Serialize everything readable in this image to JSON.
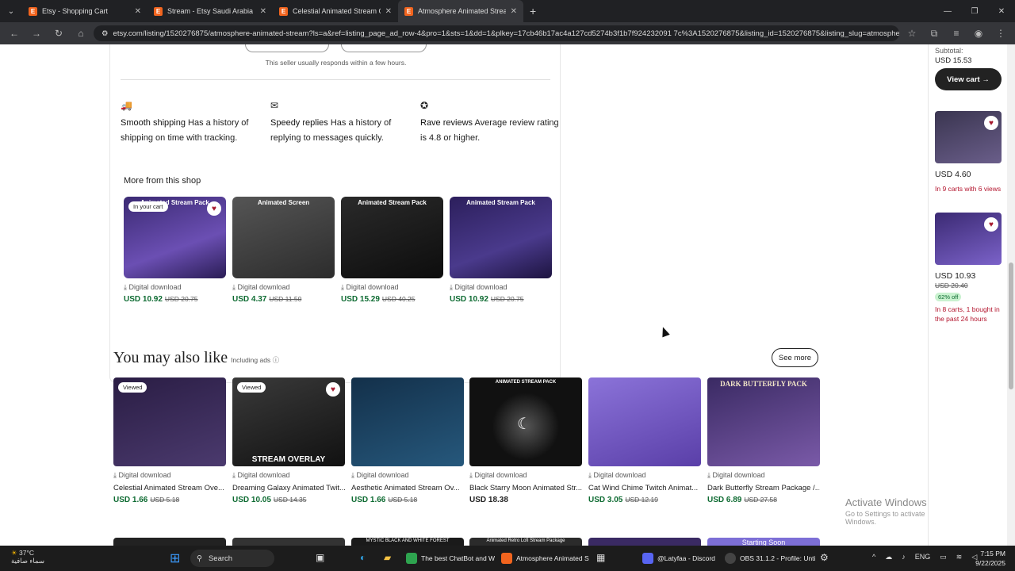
{
  "browser": {
    "tabs": [
      {
        "title": "Etsy - Shopping Cart",
        "active": false
      },
      {
        "title": "Stream - Etsy Saudi Arabia",
        "active": false
      },
      {
        "title": "Celestial Animated Stream Ove",
        "active": false
      },
      {
        "title": "Atmosphere Animated Stream",
        "active": true
      }
    ],
    "url": "etsy.com/listing/1520276875/atmosphere-animated-stream?ls=a&ref=listing_page_ad_row-4&pro=1&sts=1&dd=1&plkey=17cb46b17ac4a127cd5274b3f1b7f924232091 7c%3A1520276875&listing_id=1520276875&listing_slug=atmosphere-animated-stream-a"
  },
  "shop": {
    "response_note": "This seller usually responds within a few hours.",
    "features": [
      {
        "icon": "truck-icon",
        "title": "Smooth shipping",
        "desc": "Has a history of shipping on time with tracking."
      },
      {
        "icon": "envelope-icon",
        "title": "Speedy replies",
        "desc": "Has a history of replying to messages quickly."
      },
      {
        "icon": "star-badge-icon",
        "title": "Rave reviews",
        "desc": "Average review rating is 4.8 or higher."
      }
    ],
    "more_title": "More from this shop",
    "items": [
      {
        "label": "Animated Stream Pack",
        "badge": "In your cart",
        "favorited": true,
        "type": "Digital download",
        "price": "USD 10.92",
        "original": "USD 20.75",
        "bg": "#3b2a73"
      },
      {
        "label": "Animated Screen",
        "badge": "",
        "favorited": false,
        "type": "Digital download",
        "price": "USD 4.37",
        "original": "USD 11.50",
        "bg": "#3a3a3a"
      },
      {
        "label": "Animated Stream Pack",
        "badge": "",
        "favorited": false,
        "type": "Digital download",
        "price": "USD 15.29",
        "original": "USD 40.25",
        "bg": "#1a1a1a"
      },
      {
        "label": "Animated Stream Pack",
        "badge": "",
        "favorited": false,
        "type": "Digital download",
        "price": "USD 10.92",
        "original": "USD 20.75",
        "bg": "#2c1f5c"
      }
    ]
  },
  "recommend": {
    "title": "You may also like",
    "subtitle": "Including ads",
    "see_more": "See more",
    "items": [
      {
        "name": "Celestial Animated Stream Ove...",
        "badge": "Viewed",
        "favorited": false,
        "type": "Digital download",
        "price": "USD 1.66",
        "original": "USD 5.18",
        "bg": "#2a1d44"
      },
      {
        "name": "Dreaming Galaxy Animated Twit...",
        "badge": "Viewed",
        "favorited": true,
        "type": "Digital download",
        "price": "USD 10.05",
        "original": "USD 14.35",
        "bg": "#222222",
        "caption": "STREAM OVERLAY"
      },
      {
        "name": "Aesthetic Animated Stream Ov...",
        "badge": "",
        "favorited": false,
        "type": "Digital download",
        "price": "USD 1.66",
        "original": "USD 5.18",
        "bg": "#13304a"
      },
      {
        "name": "Black Starry Moon Animated Str...",
        "badge": "",
        "favorited": false,
        "type": "Digital download",
        "price": "USD 18.38",
        "original": "",
        "bg": "#111111",
        "caption_top": "ANIMATED STREAM PACK"
      },
      {
        "name": "Cat Wind Chime Twitch Animat...",
        "badge": "",
        "favorited": false,
        "type": "Digital download",
        "price": "USD 3.05",
        "original": "USD 12.19",
        "bg": "#6b4fb3"
      },
      {
        "name": "Dark Butterfly Stream Package /...",
        "badge": "",
        "favorited": false,
        "type": "Digital download",
        "price": "USD 6.89",
        "original": "USD 27.58",
        "bg": "#3a2a63",
        "caption_top": "DARK BUTTERFLY PACK"
      }
    ],
    "row_two": [
      {
        "label": "",
        "bg": "#222"
      },
      {
        "label": "",
        "bg": "#333"
      },
      {
        "label": "MYSTIC BLACK AND WHITE FOREST",
        "bg": "#1a1a1a"
      },
      {
        "label": "Animated Retro Lofi Stream Package",
        "bg": "#2b2b2b"
      },
      {
        "label": "",
        "bg": "#3a2a63"
      },
      {
        "label": "Starting Soon",
        "bg": "#7d6fd6"
      }
    ]
  },
  "cart_sidebar": {
    "subtotal_label": "Subtotal:",
    "subtotal": "USD 15.53",
    "view_cart": "View cart",
    "items": [
      {
        "price": "USD 4.60",
        "note": "In 9 carts with 6 views",
        "original": "",
        "off": "",
        "bg": "#3a3550"
      },
      {
        "price": "USD 10.93",
        "original": "USD 20.40",
        "off": "62% off",
        "note": "In 8 carts, 1 bought in the past 24 hours",
        "bg": "#3b2a73"
      }
    ]
  },
  "windows": {
    "activate_title": "Activate Windows",
    "activate_sub": "Go to Settings to activate Windows.",
    "weather_temp": "37°C",
    "weather_desc": "سماء صافية",
    "search": "Search",
    "apps": [
      {
        "label": "The best ChatBot and W",
        "color": "#2ea44f"
      },
      {
        "label": "Atmosphere Animated S",
        "color": "#f1641e"
      },
      {
        "label": "@Latyfaa - Discord",
        "color": "#5865f2"
      },
      {
        "label": "OBS 31.1.2 - Profile: Unti",
        "color": "#444"
      }
    ],
    "lang": "ENG",
    "time": "7:15 PM",
    "date": "9/22/2025"
  }
}
